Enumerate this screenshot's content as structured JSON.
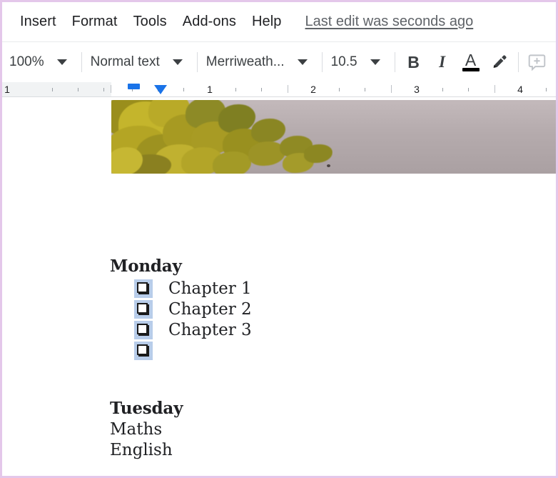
{
  "app": {
    "name": "Google Docs",
    "accent_color": "#1a73e8",
    "frame_color": "#e4c7ea"
  },
  "menubar": {
    "items": [
      {
        "label": "Insert",
        "name": "menu-insert"
      },
      {
        "label": "Format",
        "name": "menu-format"
      },
      {
        "label": "Tools",
        "name": "menu-tools"
      },
      {
        "label": "Add-ons",
        "name": "menu-addons"
      },
      {
        "label": "Help",
        "name": "menu-help"
      }
    ],
    "last_edit": "Last edit was seconds ago"
  },
  "toolbar": {
    "zoom_value": "100%",
    "paragraph_style": "Normal text",
    "font_family": "Merriweath...",
    "font_size": "10.5",
    "bold_label": "B",
    "italic_label": "I",
    "text_color_label": "A",
    "text_color_swatch": "#000000",
    "highlight_icon": "highlighter-pen-icon",
    "comment_icon": "add-comment-icon"
  },
  "ruler": {
    "unit": "inches",
    "numbers": [
      "1",
      "1",
      "2",
      "3",
      "4"
    ],
    "left_indent_marker": "left-indent-marker",
    "first_line_indent_marker": "first-line-indent-marker"
  },
  "document": {
    "image": {
      "alt": "photo of yellow-green tree foliage against a pale mauve sky",
      "sky_color": "#b5abad",
      "foliage_color": "#b2a623"
    },
    "sections": [
      {
        "heading": "Monday",
        "items": [
          {
            "checked": false,
            "label": "Chapter 1"
          },
          {
            "checked": false,
            "label": "Chapter 2"
          },
          {
            "checked": false,
            "label": "Chapter 3"
          },
          {
            "checked": false,
            "label": ""
          }
        ]
      },
      {
        "heading": "Tuesday",
        "lines": [
          "Maths",
          "English"
        ]
      }
    ]
  }
}
